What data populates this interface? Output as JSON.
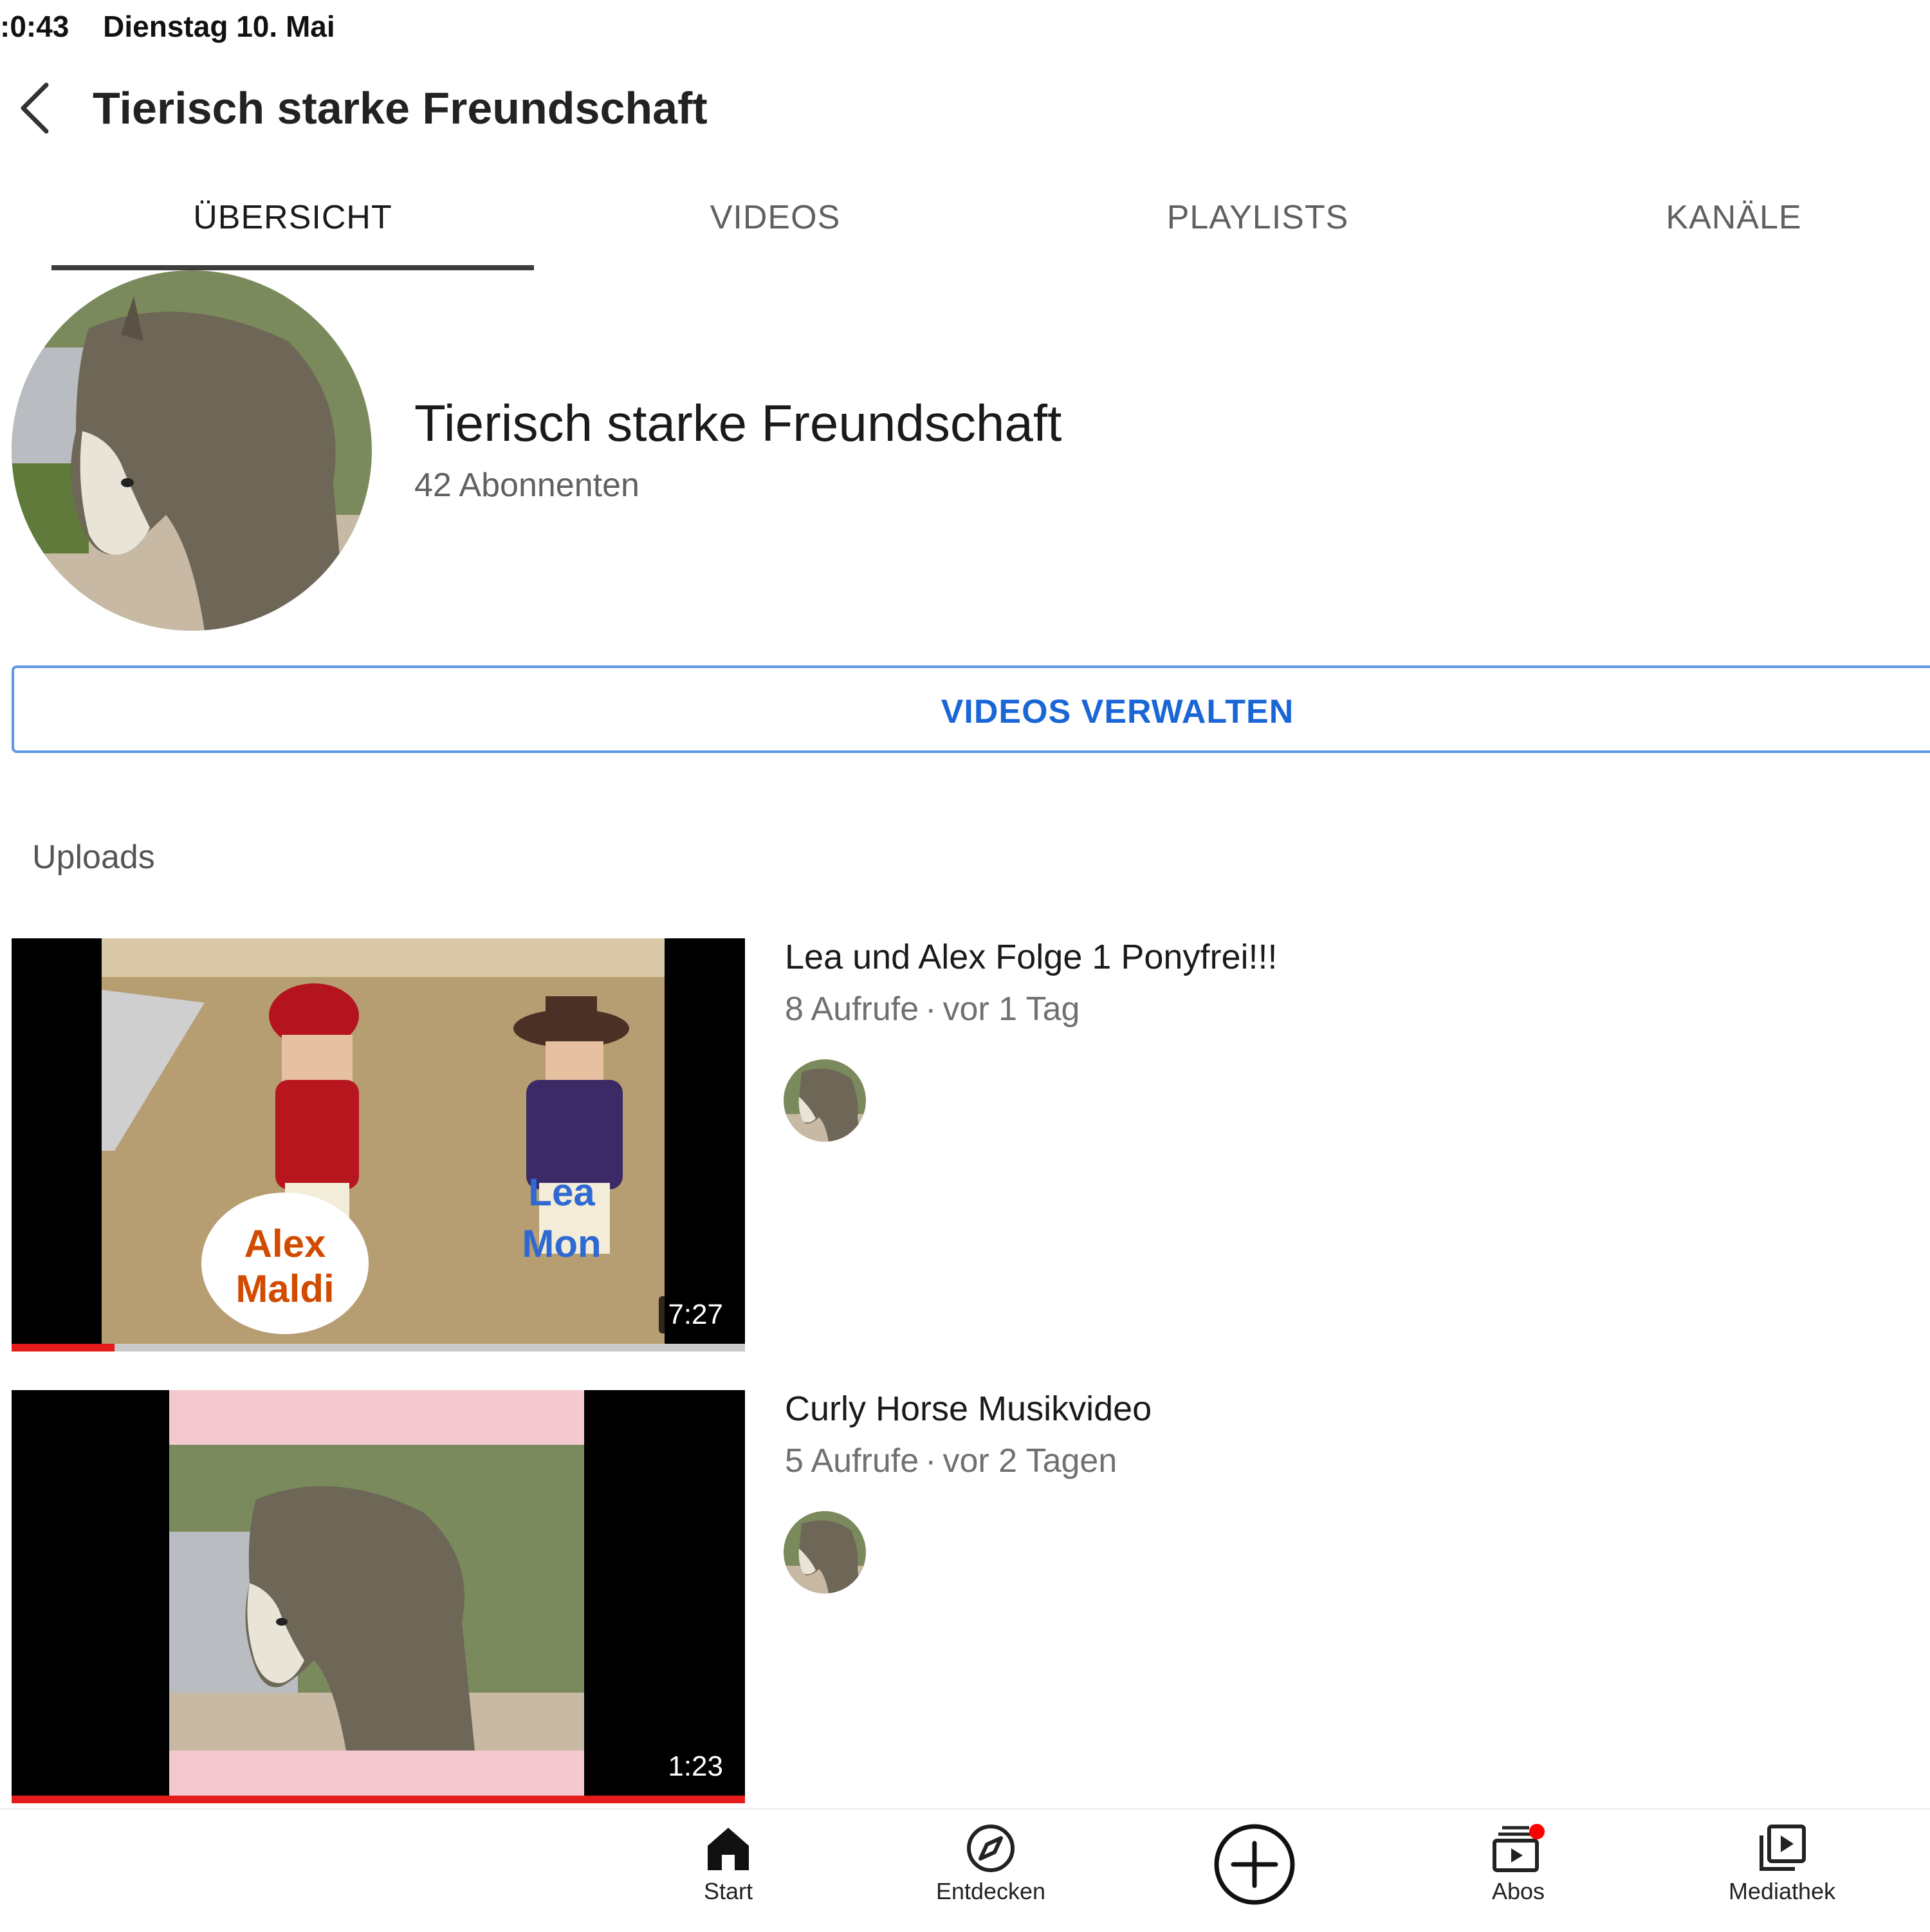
{
  "status_bar": {
    "time": ":0:43",
    "date": "Dienstag 10. Mai"
  },
  "header": {
    "title": "Tierisch starke Freundschaft"
  },
  "tabs": [
    {
      "label": "ÜBERSICHT",
      "active": true
    },
    {
      "label": "VIDEOS",
      "active": false
    },
    {
      "label": "PLAYLISTS",
      "active": false
    },
    {
      "label": "KANÄLE",
      "active": false
    }
  ],
  "channel": {
    "name": "Tierisch starke Freundschaft",
    "subscribers": "42 Abonnenten"
  },
  "manage_button": {
    "label": "VIDEOS VERWALTEN"
  },
  "section": {
    "uploads_label": "Uploads"
  },
  "videos": [
    {
      "title": "Lea und Alex Folge 1 Ponyfrei!!!",
      "views": "8 Aufrufe",
      "age": "vor 1 Tag",
      "duration": "7:27",
      "watched_fraction": 0.14,
      "thumb_text_1": "Alex Maldi",
      "thumb_text_2": "Lea Mon"
    },
    {
      "title": "Curly Horse Musikvideo",
      "views": "5 Aufrufe",
      "age": "vor 2 Tagen",
      "duration": "1:23",
      "watched_fraction": 1.0
    }
  ],
  "meta_separator": "·",
  "bottom_nav": [
    {
      "label": "Start",
      "icon": "home-icon"
    },
    {
      "label": "Entdecken",
      "icon": "compass-icon"
    },
    {
      "label": "",
      "icon": "create-plus-icon"
    },
    {
      "label": "Abos",
      "icon": "subscriptions-icon"
    },
    {
      "label": "Mediathek",
      "icon": "library-icon"
    }
  ],
  "colors": {
    "accent_blue": "#1a66d6",
    "progress_red": "#e51c1c",
    "notification_dot": "#ff0000"
  }
}
